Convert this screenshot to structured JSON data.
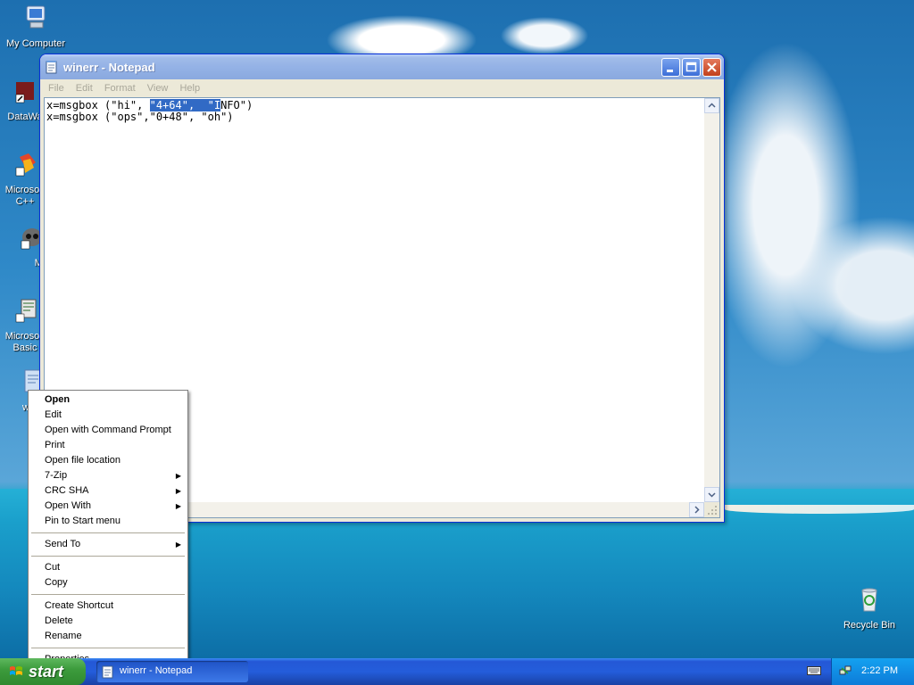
{
  "desktop": {
    "icons": [
      {
        "label": "My Computer"
      },
      {
        "label": "DataWa"
      },
      {
        "label": "Microsoft C++"
      },
      {
        "label": "Myp"
      },
      {
        "label": "Microsoft Basic"
      },
      {
        "label": "w"
      },
      {
        "label": "Recycle Bin"
      }
    ]
  },
  "notepad": {
    "title": "winerr - Notepad",
    "menu": [
      "File",
      "Edit",
      "Format",
      "View",
      "Help"
    ],
    "line1_a": "x=msgbox (\"hi\", ",
    "line1_sel": "\"4+64\",  \"I",
    "line1_b": "NFO\")",
    "line2": "x=msgbox (\"ops\",\"0+48\", \"oh\")"
  },
  "context_menu": {
    "items": [
      {
        "label": "Open",
        "bold": true
      },
      {
        "label": "Edit"
      },
      {
        "label": "Open with Command Prompt"
      },
      {
        "label": "Print"
      },
      {
        "label": "Open file location"
      },
      {
        "label": "7-Zip",
        "submenu": true
      },
      {
        "label": "CRC SHA",
        "submenu": true
      },
      {
        "label": "Open With",
        "submenu": true
      },
      {
        "label": "Pin to Start menu"
      },
      {
        "label": "Send To",
        "submenu": true
      },
      {
        "label": "Cut"
      },
      {
        "label": "Copy"
      },
      {
        "label": "Create Shortcut"
      },
      {
        "label": "Delete"
      },
      {
        "label": "Rename"
      },
      {
        "label": "Properties"
      }
    ]
  },
  "taskbar": {
    "start_label": "start",
    "task_title": "winerr - Notepad",
    "clock": "2:22 PM"
  }
}
